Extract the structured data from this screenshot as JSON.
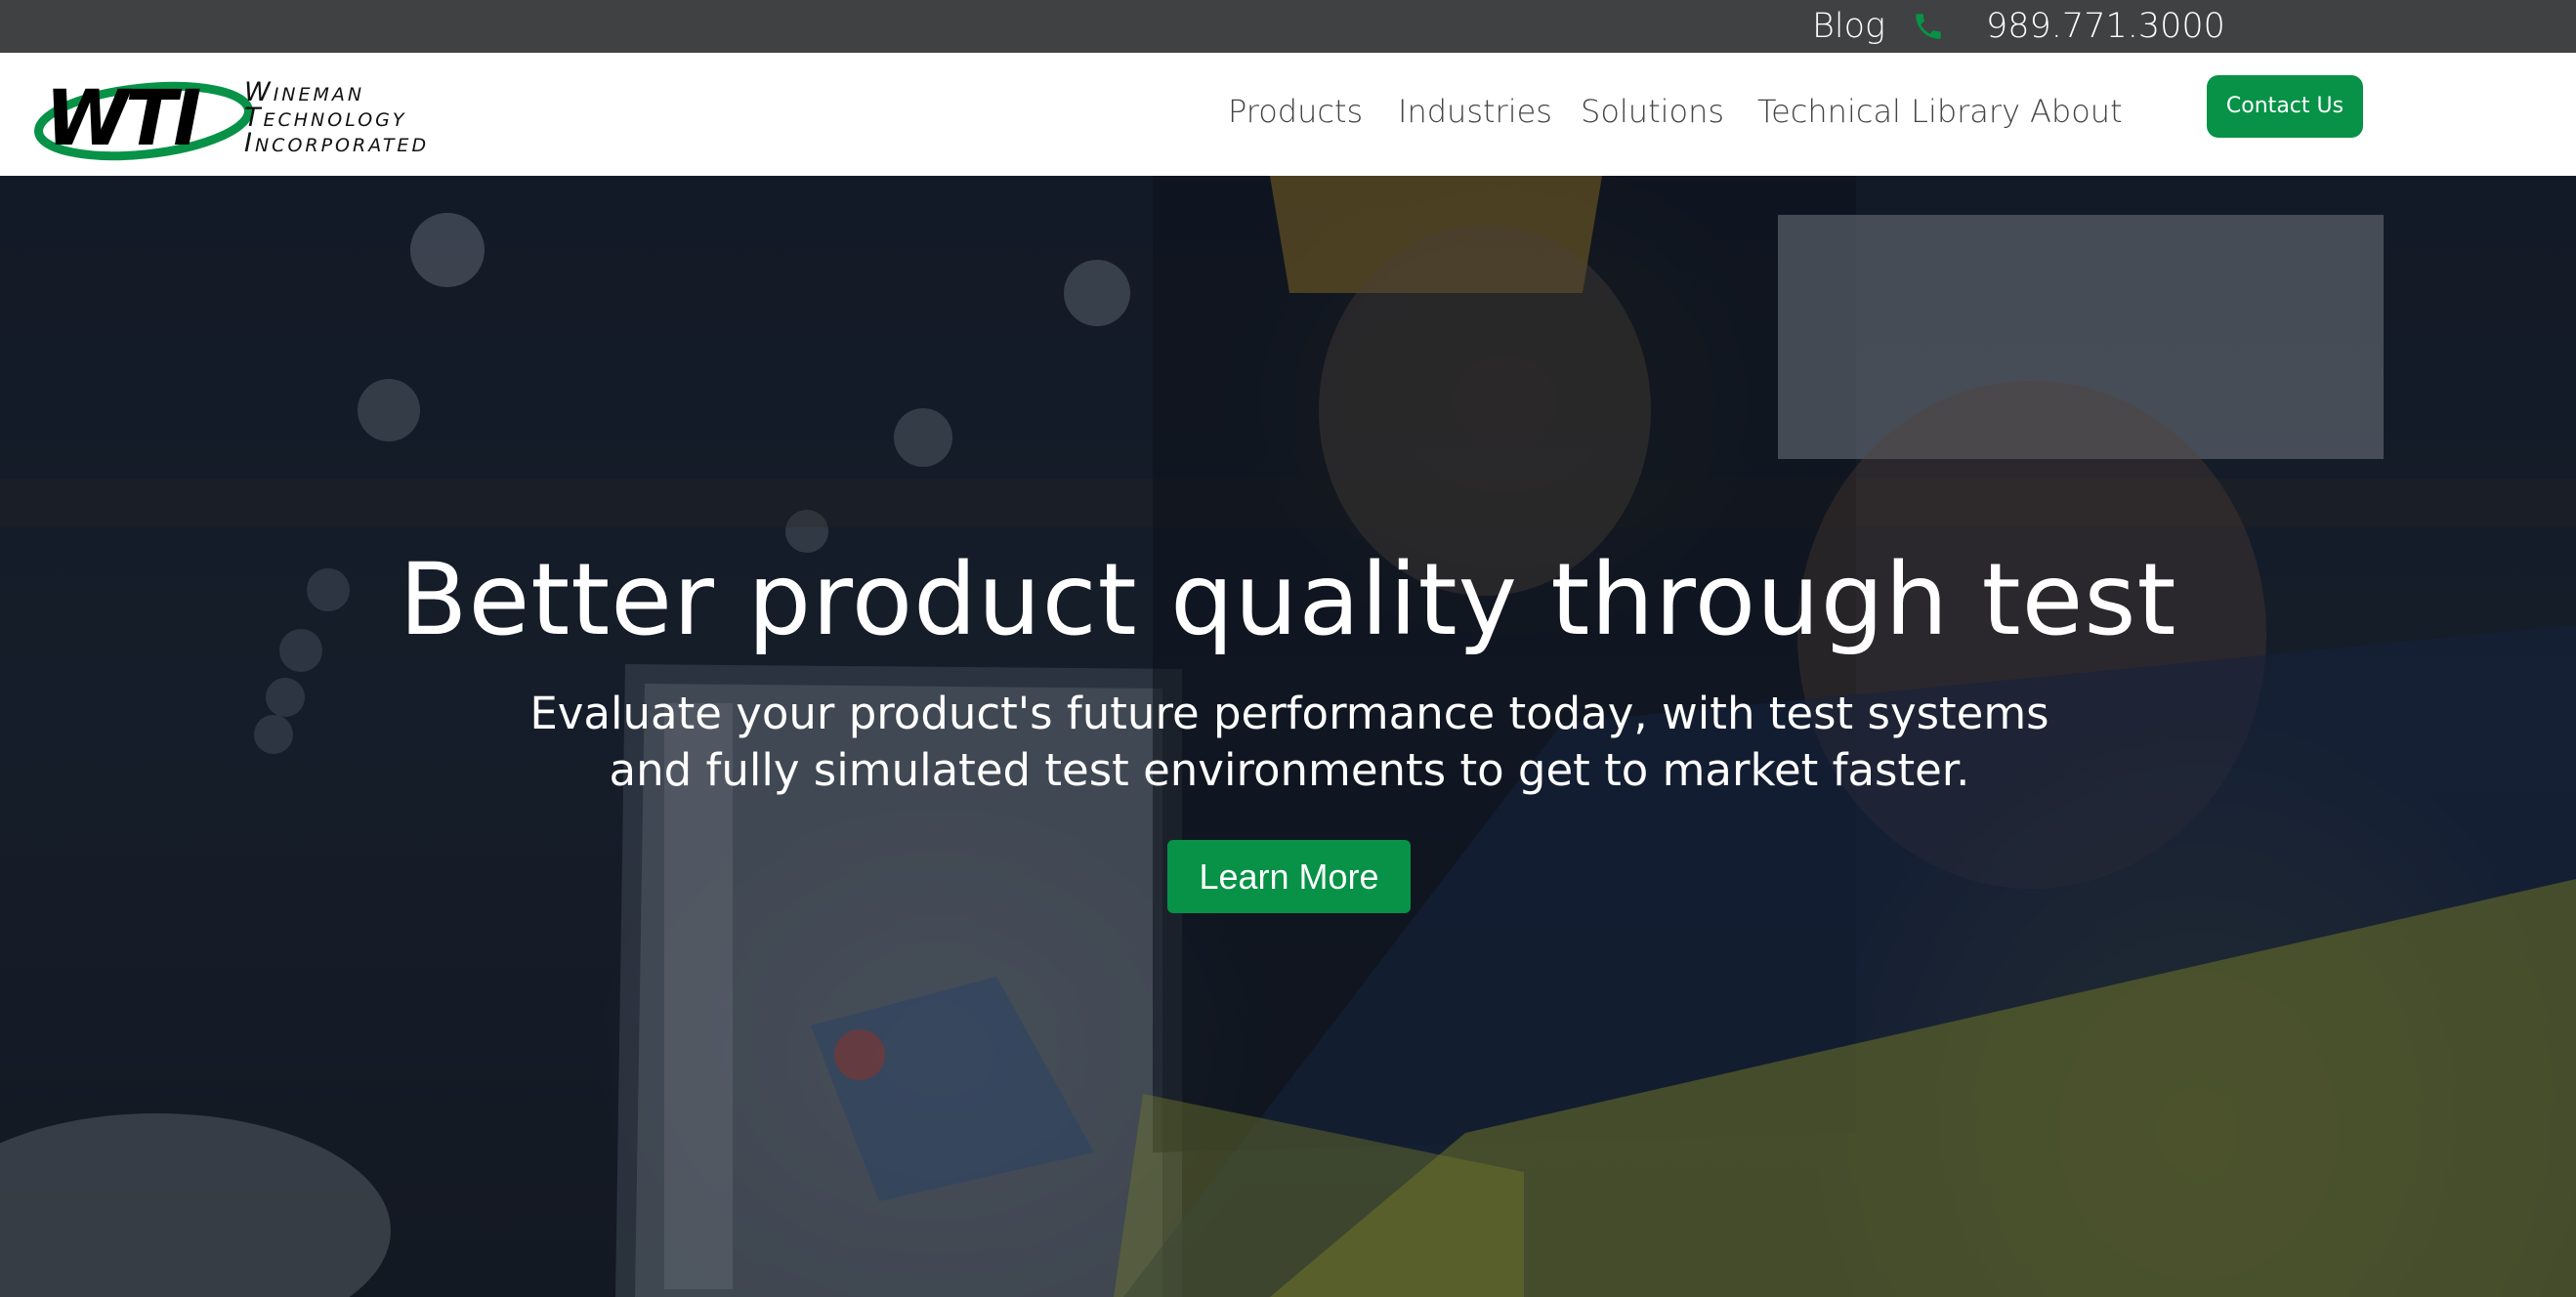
{
  "topbar": {
    "blog_label": "Blog",
    "phone_icon": "phone-icon",
    "phone_number": "989.771.3000"
  },
  "navbar": {
    "logo": {
      "mark": "WTI",
      "line1": "Wineman",
      "line2": "Technology",
      "line3": "Incorporated"
    },
    "links": [
      {
        "label": "Products"
      },
      {
        "label": "Industries"
      },
      {
        "label": "Solutions"
      },
      {
        "label": "Technical Library"
      },
      {
        "label": "About"
      }
    ],
    "contact_label": "Contact Us"
  },
  "hero": {
    "title": "Better product quality through test",
    "subtitle": "Evaluate your product's future performance today, with test systems and fully simulated test environments to get to market faster.",
    "cta_label": "Learn More"
  },
  "colors": {
    "topbar_bg": "#404142",
    "brand_green": "#079247",
    "nav_text": "#444444",
    "hero_text": "#ffffff"
  }
}
